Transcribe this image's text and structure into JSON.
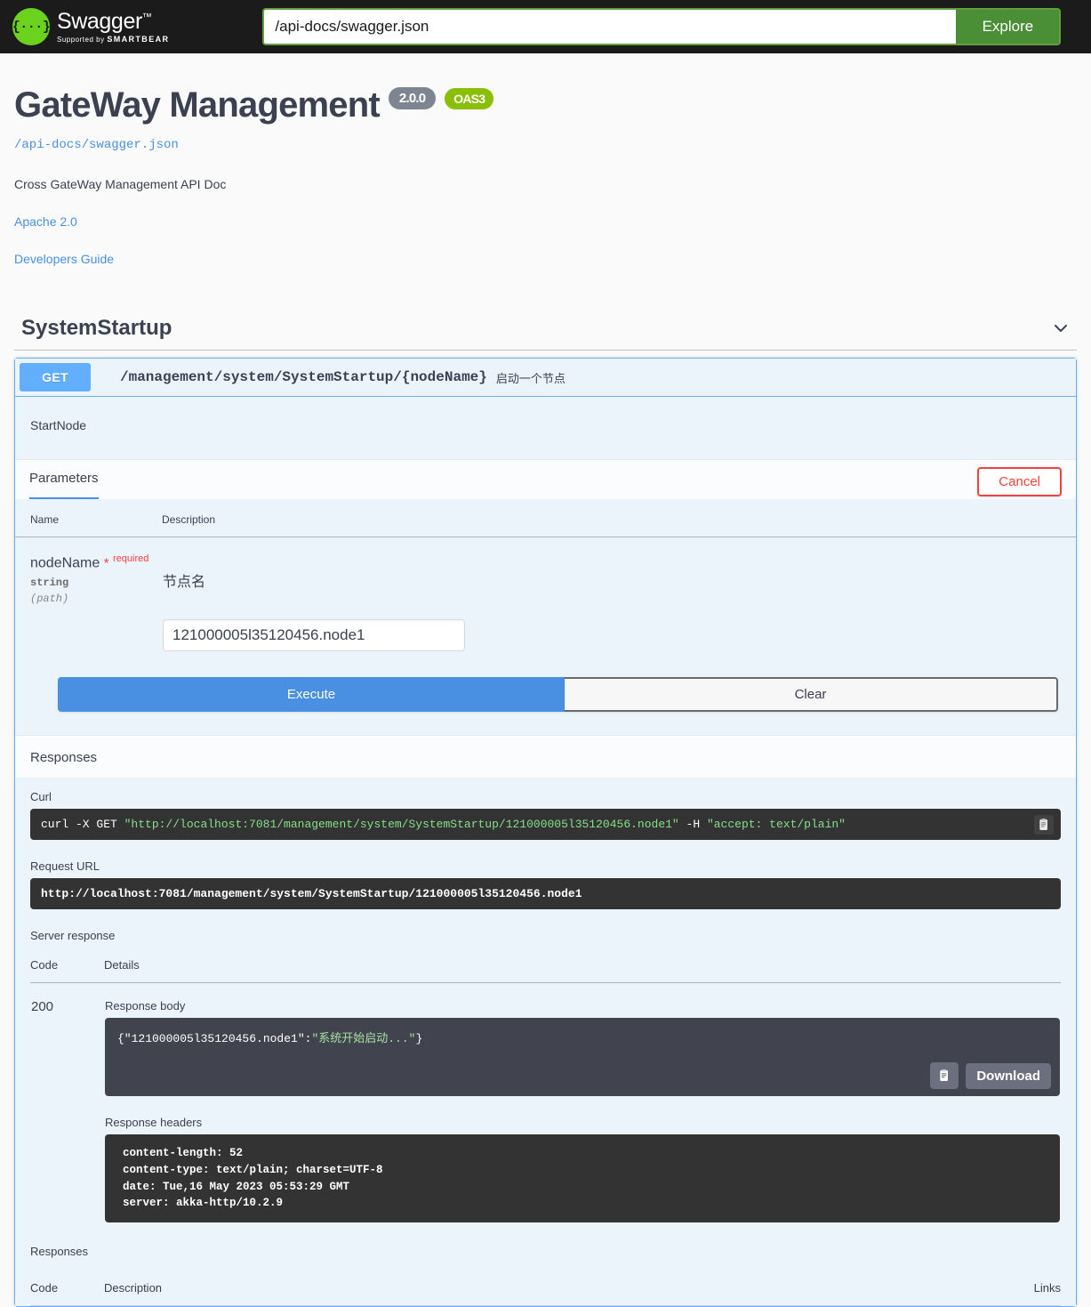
{
  "topbar": {
    "logo_title": "Swagger",
    "logo_trademark": "™",
    "logo_supported_prefix": "Supported by ",
    "logo_supported_brand": "SMARTBEAR",
    "url_value": "/api-docs/swagger.json",
    "url_placeholder": "/api-docs/swagger.json",
    "explore_label": "Explore"
  },
  "info": {
    "title": "GateWay Management",
    "version": "2.0.0",
    "oas_badge": "OAS3",
    "spec_url": "/api-docs/swagger.json",
    "description": "Cross GateWay Management API Doc",
    "license": "Apache 2.0",
    "external_docs": "Developers Guide"
  },
  "tag": {
    "name": "SystemStartup",
    "collapse_icon": "chevron-down-icon"
  },
  "operation": {
    "method": "GET",
    "path": "/management/system/SystemStartup/{nodeName}",
    "summary": "启动一个节点",
    "description": "StartNode",
    "parameters_tab": "Parameters",
    "cancel_label": "Cancel",
    "table_headers": {
      "name": "Name",
      "description": "Description"
    },
    "parameters": [
      {
        "name": "nodeName",
        "required_star": "*",
        "required_label": "required",
        "type": "string",
        "in": "(path)",
        "description": "节点名",
        "value": "121000005l35120456.node1"
      }
    ],
    "execute_label": "Execute",
    "clear_label": "Clear"
  },
  "responses_section": {
    "title": "Responses",
    "curl_label": "Curl",
    "curl_prefix": "curl -X GET ",
    "curl_url": "\"http://localhost:7081/management/system/SystemStartup/121000005l35120456.node1\"",
    "curl_mid": " -H ",
    "curl_accept": "\"accept: text/plain\"",
    "copy_icon": "copy-to-clipboard-icon",
    "request_url_label": "Request URL",
    "request_url": "http://localhost:7081/management/system/SystemStartup/121000005l35120456.node1",
    "server_response_label": "Server response",
    "table_headers": {
      "code": "Code",
      "details": "Details"
    },
    "result": {
      "code": "200",
      "response_body_label": "Response body",
      "response_body_key": "{\"121000005l35120456.node1\":",
      "response_body_value": "\"系统开始启动...\"",
      "response_body_close": "}",
      "download_label": "Download",
      "response_headers_label": "Response headers",
      "response_headers": [
        "content-length: 52",
        "content-type: text/plain; charset=UTF-8",
        "date: Tue,16 May 2023 05:53:29 GMT",
        "server: akka-http/10.2.9"
      ]
    }
  },
  "responses_table": {
    "title": "Responses",
    "headers": {
      "code": "Code",
      "description": "Description",
      "links": "Links"
    }
  },
  "colors": {
    "get_blue": "#61affe",
    "execute_blue": "#4990e2",
    "cancel_red": "#f93e3e",
    "oas_green": "#89bf04",
    "explore_green": "#4a8f35",
    "logo_green": "#6bd31e"
  }
}
